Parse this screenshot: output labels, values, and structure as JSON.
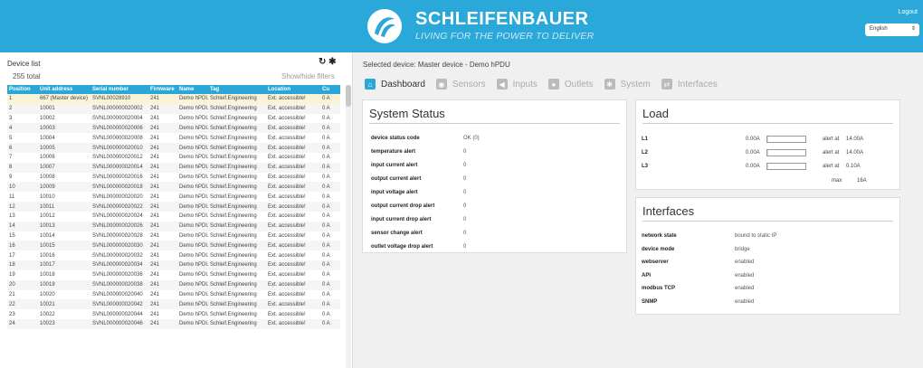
{
  "header": {
    "brand": "SCHLEIFENBAUER",
    "tagline": "LIVING FOR THE POWER TO DELIVER",
    "logout": "Logout",
    "language": "English"
  },
  "left": {
    "title": "Device list",
    "total": "255 total",
    "show_hide": "Show/hide filters",
    "columns": [
      "Position",
      "Unit address",
      "Serial number",
      "Firmware",
      "Name",
      "Tag",
      "Location",
      "Cu"
    ],
    "rows": [
      [
        "1",
        "667 (Master device)",
        "SVNL00028910",
        "241",
        "Demo hPDU",
        "Schleif.Engineering",
        "Ext. accessible!",
        "0 A"
      ],
      [
        "2",
        "10001",
        "SVNL000000020002",
        "241",
        "Demo hPDU",
        "Schleif.Engineering",
        "Ext. accessible!",
        "0 A"
      ],
      [
        "3",
        "10002",
        "SVNL000000020004",
        "241",
        "Demo hPDU",
        "Schleif.Engineering",
        "Ext. accessible!",
        "0 A"
      ],
      [
        "4",
        "10003",
        "SVNL000000020006",
        "241",
        "Demo hPDU",
        "Schleif.Engineering",
        "Ext. accessible!",
        "0 A"
      ],
      [
        "5",
        "10004",
        "SVNL000000020008",
        "241",
        "Demo hPDU",
        "Schleif.Engineering",
        "Ext. accessible!",
        "0 A"
      ],
      [
        "6",
        "10005",
        "SVNL000000020010",
        "241",
        "Demo hPDU",
        "Schleif.Engineering",
        "Ext. accessible!",
        "0 A"
      ],
      [
        "7",
        "10006",
        "SVNL000000020012",
        "241",
        "Demo hPDU",
        "Schleif.Engineering",
        "Ext. accessible!",
        "0 A"
      ],
      [
        "8",
        "10007",
        "SVNL000000020014",
        "241",
        "Demo hPDU",
        "Schleif.Engineering",
        "Ext. accessible!",
        "0 A"
      ],
      [
        "9",
        "10008",
        "SVNL000000020016",
        "241",
        "Demo hPDU",
        "Schleif.Engineering",
        "Ext. accessible!",
        "0 A"
      ],
      [
        "10",
        "10009",
        "SVNL000000020018",
        "241",
        "Demo hPDU",
        "Schleif.Engineering",
        "Ext. accessible!",
        "0 A"
      ],
      [
        "11",
        "10010",
        "SVNL000000020020",
        "241",
        "Demo hPDU",
        "Schleif.Engineering",
        "Ext. accessible!",
        "0 A"
      ],
      [
        "12",
        "10011",
        "SVNL000000020022",
        "241",
        "Demo hPDU",
        "Schleif.Engineering",
        "Ext. accessible!",
        "0 A"
      ],
      [
        "13",
        "10012",
        "SVNL000000020024",
        "241",
        "Demo hPDU",
        "Schleif.Engineering",
        "Ext. accessible!",
        "0 A"
      ],
      [
        "14",
        "10013",
        "SVNL000000020026",
        "241",
        "Demo hPDU",
        "Schleif.Engineering",
        "Ext. accessible!",
        "0 A"
      ],
      [
        "15",
        "10014",
        "SVNL000000020028",
        "241",
        "Demo hPDU",
        "Schleif.Engineering",
        "Ext. accessible!",
        "0 A"
      ],
      [
        "16",
        "10015",
        "SVNL000000020030",
        "241",
        "Demo hPDU",
        "Schleif.Engineering",
        "Ext. accessible!",
        "0 A"
      ],
      [
        "17",
        "10016",
        "SVNL000000020032",
        "241",
        "Demo hPDU",
        "Schleif.Engineering",
        "Ext. accessible!",
        "0 A"
      ],
      [
        "18",
        "10017",
        "SVNL000000020034",
        "241",
        "Demo hPDU",
        "Schleif.Engineering",
        "Ext. accessible!",
        "0 A"
      ],
      [
        "19",
        "10018",
        "SVNL000000020036",
        "241",
        "Demo hPDU",
        "Schleif.Engineering",
        "Ext. accessible!",
        "0 A"
      ],
      [
        "20",
        "10019",
        "SVNL000000020038",
        "241",
        "Demo hPDU",
        "Schleif.Engineering",
        "Ext. accessible!",
        "0 A"
      ],
      [
        "21",
        "10020",
        "SVNL000000020040",
        "241",
        "Demo hPDU",
        "Schleif.Engineering",
        "Ext. accessible!",
        "0 A"
      ],
      [
        "22",
        "10021",
        "SVNL000000020042",
        "241",
        "Demo hPDU",
        "Schleif.Engineering",
        "Ext. accessible!",
        "0 A"
      ],
      [
        "23",
        "10022",
        "SVNL000000020044",
        "241",
        "Demo hPDU",
        "Schleif.Engineering",
        "Ext. accessible!",
        "0 A"
      ],
      [
        "24",
        "10023",
        "SVNL000000020046",
        "241",
        "Demo hPDU",
        "Schleif.Engineering",
        "Ext. accessible!",
        "0 A"
      ]
    ]
  },
  "right": {
    "selected": "Selected device: Master device - Demo hPDU",
    "tabs": [
      {
        "label": "Dashboard",
        "icon": "home-icon",
        "glyph": "⌂"
      },
      {
        "label": "Sensors",
        "icon": "sensor-icon",
        "glyph": "◉"
      },
      {
        "label": "Inputs",
        "icon": "input-icon",
        "glyph": "◀"
      },
      {
        "label": "Outlets",
        "icon": "outlet-icon",
        "glyph": "●"
      },
      {
        "label": "System",
        "icon": "gear-icon",
        "glyph": "✱"
      },
      {
        "label": "Interfaces",
        "icon": "interfaces-icon",
        "glyph": "⇄"
      }
    ],
    "system_status": {
      "title": "System Status",
      "rows": [
        {
          "k": "device status code",
          "v": "OK (0)"
        },
        {
          "k": "temperature alert",
          "v": "0"
        },
        {
          "k": "input current alert",
          "v": "0"
        },
        {
          "k": "output current alert",
          "v": "0"
        },
        {
          "k": "input voltage alert",
          "v": "0"
        },
        {
          "k": "output current drop alert",
          "v": "0"
        },
        {
          "k": "input current drop alert",
          "v": "0"
        },
        {
          "k": "sensor change alert",
          "v": "0"
        },
        {
          "k": "outlet voltage drop alert",
          "v": "0"
        }
      ]
    },
    "load": {
      "title": "Load",
      "rows": [
        {
          "k": "L1",
          "v": "0.00A",
          "alert": "alert at",
          "limit": "14.00A",
          "level": 0.02
        },
        {
          "k": "L2",
          "v": "0.00A",
          "alert": "alert at",
          "limit": "14.00A",
          "level": 0.02
        },
        {
          "k": "L3",
          "v": "0.00A",
          "alert": "alert at",
          "limit": "0.10A",
          "level": 0.02
        }
      ],
      "max_label": "max",
      "max_value": "16A"
    },
    "interfaces": {
      "title": "Interfaces",
      "rows": [
        {
          "k": "network state",
          "v": "bound to static IP"
        },
        {
          "k": "device mode",
          "v": "bridge"
        },
        {
          "k": "webserver",
          "v": "enabled"
        },
        {
          "k": "API",
          "v": "enabled"
        },
        {
          "k": "modbus TCP",
          "v": "enabled"
        },
        {
          "k": "SNMP",
          "v": "enabled"
        }
      ]
    }
  }
}
